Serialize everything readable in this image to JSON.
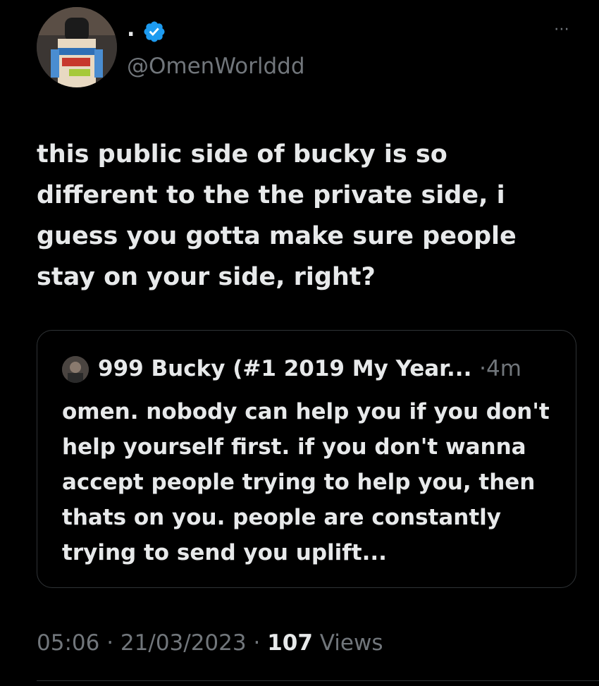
{
  "tweet": {
    "display_name": ".",
    "handle": "@OmenWorlddd",
    "more_icon": "⋯",
    "text": "this public side of bucky is so different to the the private side, i guess you gotta make sure people stay on your side, right?",
    "timestamp_time": "05:06",
    "separator": "·",
    "timestamp_date": "21/03/2023",
    "views_count": "107",
    "views_label": "Views",
    "verified_color": "#1d9bf0"
  },
  "quote": {
    "author": "999 Bucky (#1 2019 My Year...",
    "separator": "·",
    "time": "4m",
    "text": "omen. nobody can help you if you don't help yourself first. if you don't wanna accept people trying to help you, then thats on you. people are constantly trying to send you uplift..."
  }
}
